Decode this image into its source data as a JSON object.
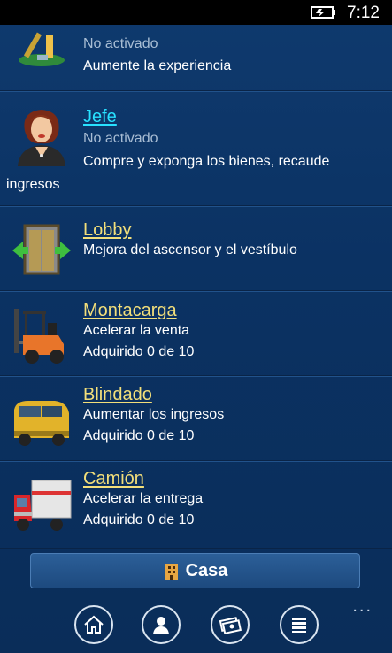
{
  "status": {
    "time": "7:12",
    "battery_icon": "battery-charging-icon"
  },
  "items": [
    {
      "icon": "trophy-icon",
      "status": "No activado",
      "desc": "Aumente la experiencia"
    },
    {
      "title": "Jefe",
      "icon": "boss-woman-icon",
      "status": "No activado",
      "desc1": "Compre y exponga los bienes, recaude",
      "desc2": "ingresos"
    },
    {
      "title": "Lobby",
      "icon": "elevator-icon",
      "desc": "Mejora del ascensor y el vestíbulo"
    },
    {
      "title": "Montacarga",
      "icon": "forklift-icon",
      "desc": "Acelerar la venta",
      "count": "Adquirido 0 de 10"
    },
    {
      "title": "Blindado",
      "icon": "armored-van-icon",
      "desc": "Aumentar los ingresos",
      "count": "Adquirido 0 de 10"
    },
    {
      "title": "Camión",
      "icon": "truck-icon",
      "desc": "Acelerar la entrega",
      "count": "Adquirido 0 de 10"
    }
  ],
  "casa_button": {
    "label": "Casa",
    "icon": "building-icon"
  },
  "appbar": {
    "more": "...",
    "buttons": [
      "home-icon",
      "person-icon",
      "money-icon",
      "list-icon"
    ]
  }
}
